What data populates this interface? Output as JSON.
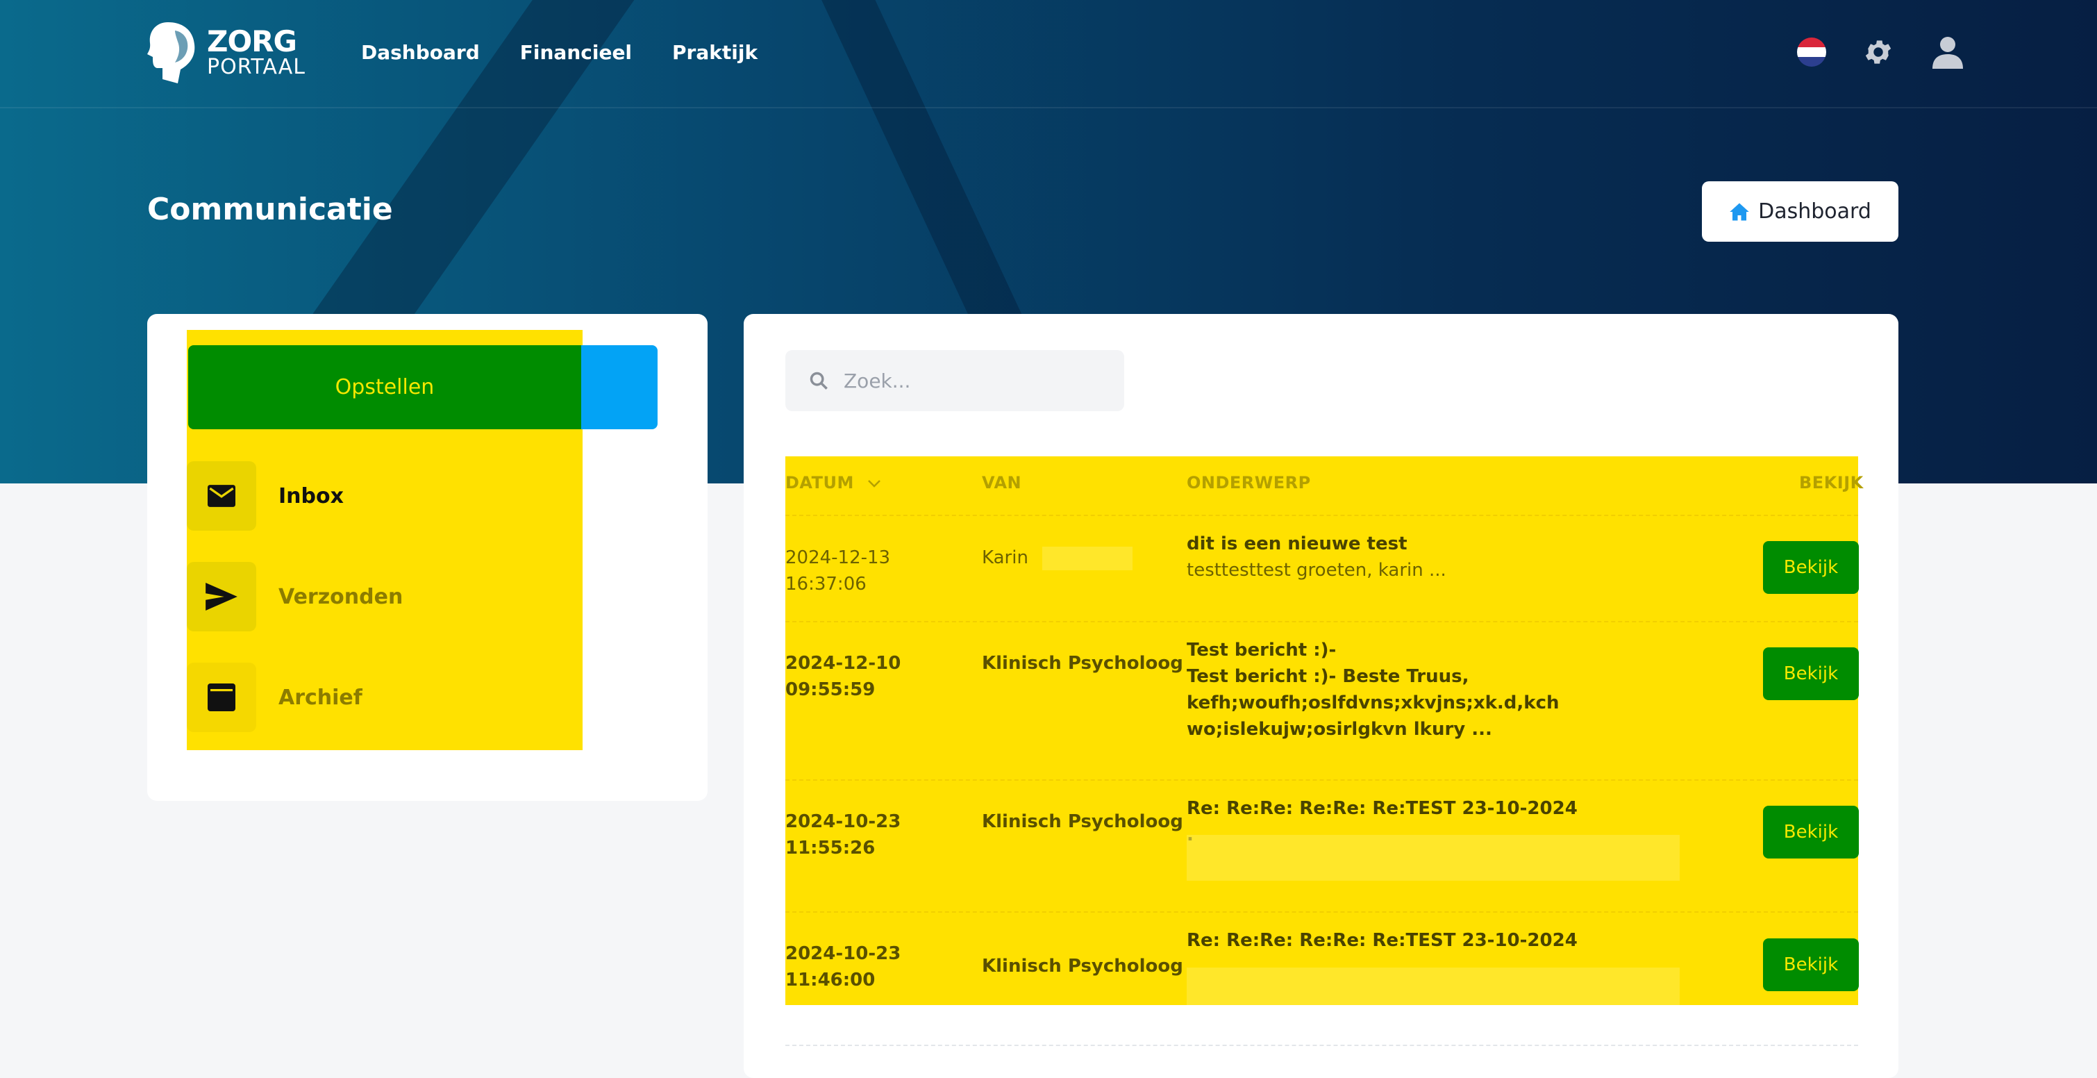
{
  "brand": {
    "line1": "ZORG",
    "line2": "PORTAAL"
  },
  "nav": [
    "Dashboard",
    "Financieel",
    "Praktijk"
  ],
  "page_title": "Communicatie",
  "dashboard_button": "Dashboard",
  "sidebar": {
    "compose_label": "Opstellen",
    "folders": [
      {
        "label": "Inbox",
        "icon": "envelope-icon",
        "active": true
      },
      {
        "label": "Verzonden",
        "icon": "send-icon",
        "active": false
      },
      {
        "label": "Archief",
        "icon": "archive-icon",
        "active": false
      }
    ]
  },
  "search": {
    "placeholder": "Zoek...",
    "value": ""
  },
  "table": {
    "headers": {
      "date": "DATUM",
      "from": "VAN",
      "subject": "ONDERWERP",
      "view": "BEKIJK"
    },
    "rows": [
      {
        "date": "2024-12-13 16:37:06",
        "from": "Karin",
        "subject": "dit is een nieuwe test",
        "preview": "testtesttest groeten, karin ...",
        "unread": false,
        "view_label": "Bekijk"
      },
      {
        "date": "2024-12-10 09:55:59",
        "from": "Klinisch Psycholoog",
        "subject": "Test bericht :)-",
        "preview": "Test bericht :)- Beste Truus, kefh;woufh;oslfdvns;xkvjns;xk.d,kch wo;islekujw;osirlgkvn lkury ...",
        "unread": true,
        "view_label": "Bekijk"
      },
      {
        "date": "2024-10-23 11:55:26",
        "from": "Klinisch Psycholoog",
        "subject": "Re: Re:Re: Re:Re: Re:TEST 23-10-2024",
        "preview": ".",
        "unread": true,
        "view_label": "Bekijk"
      },
      {
        "date": "2024-10-23 11:46:00",
        "from": "Klinisch Psycholoog",
        "subject": "Re: Re:Re: Re:Re: Re:TEST 23-10-2024",
        "preview": "",
        "unread": true,
        "view_label": "Bekijk"
      }
    ]
  },
  "colors": {
    "accent": "#03a3f5",
    "highlight": "#ffe100",
    "green": "#008c00"
  }
}
